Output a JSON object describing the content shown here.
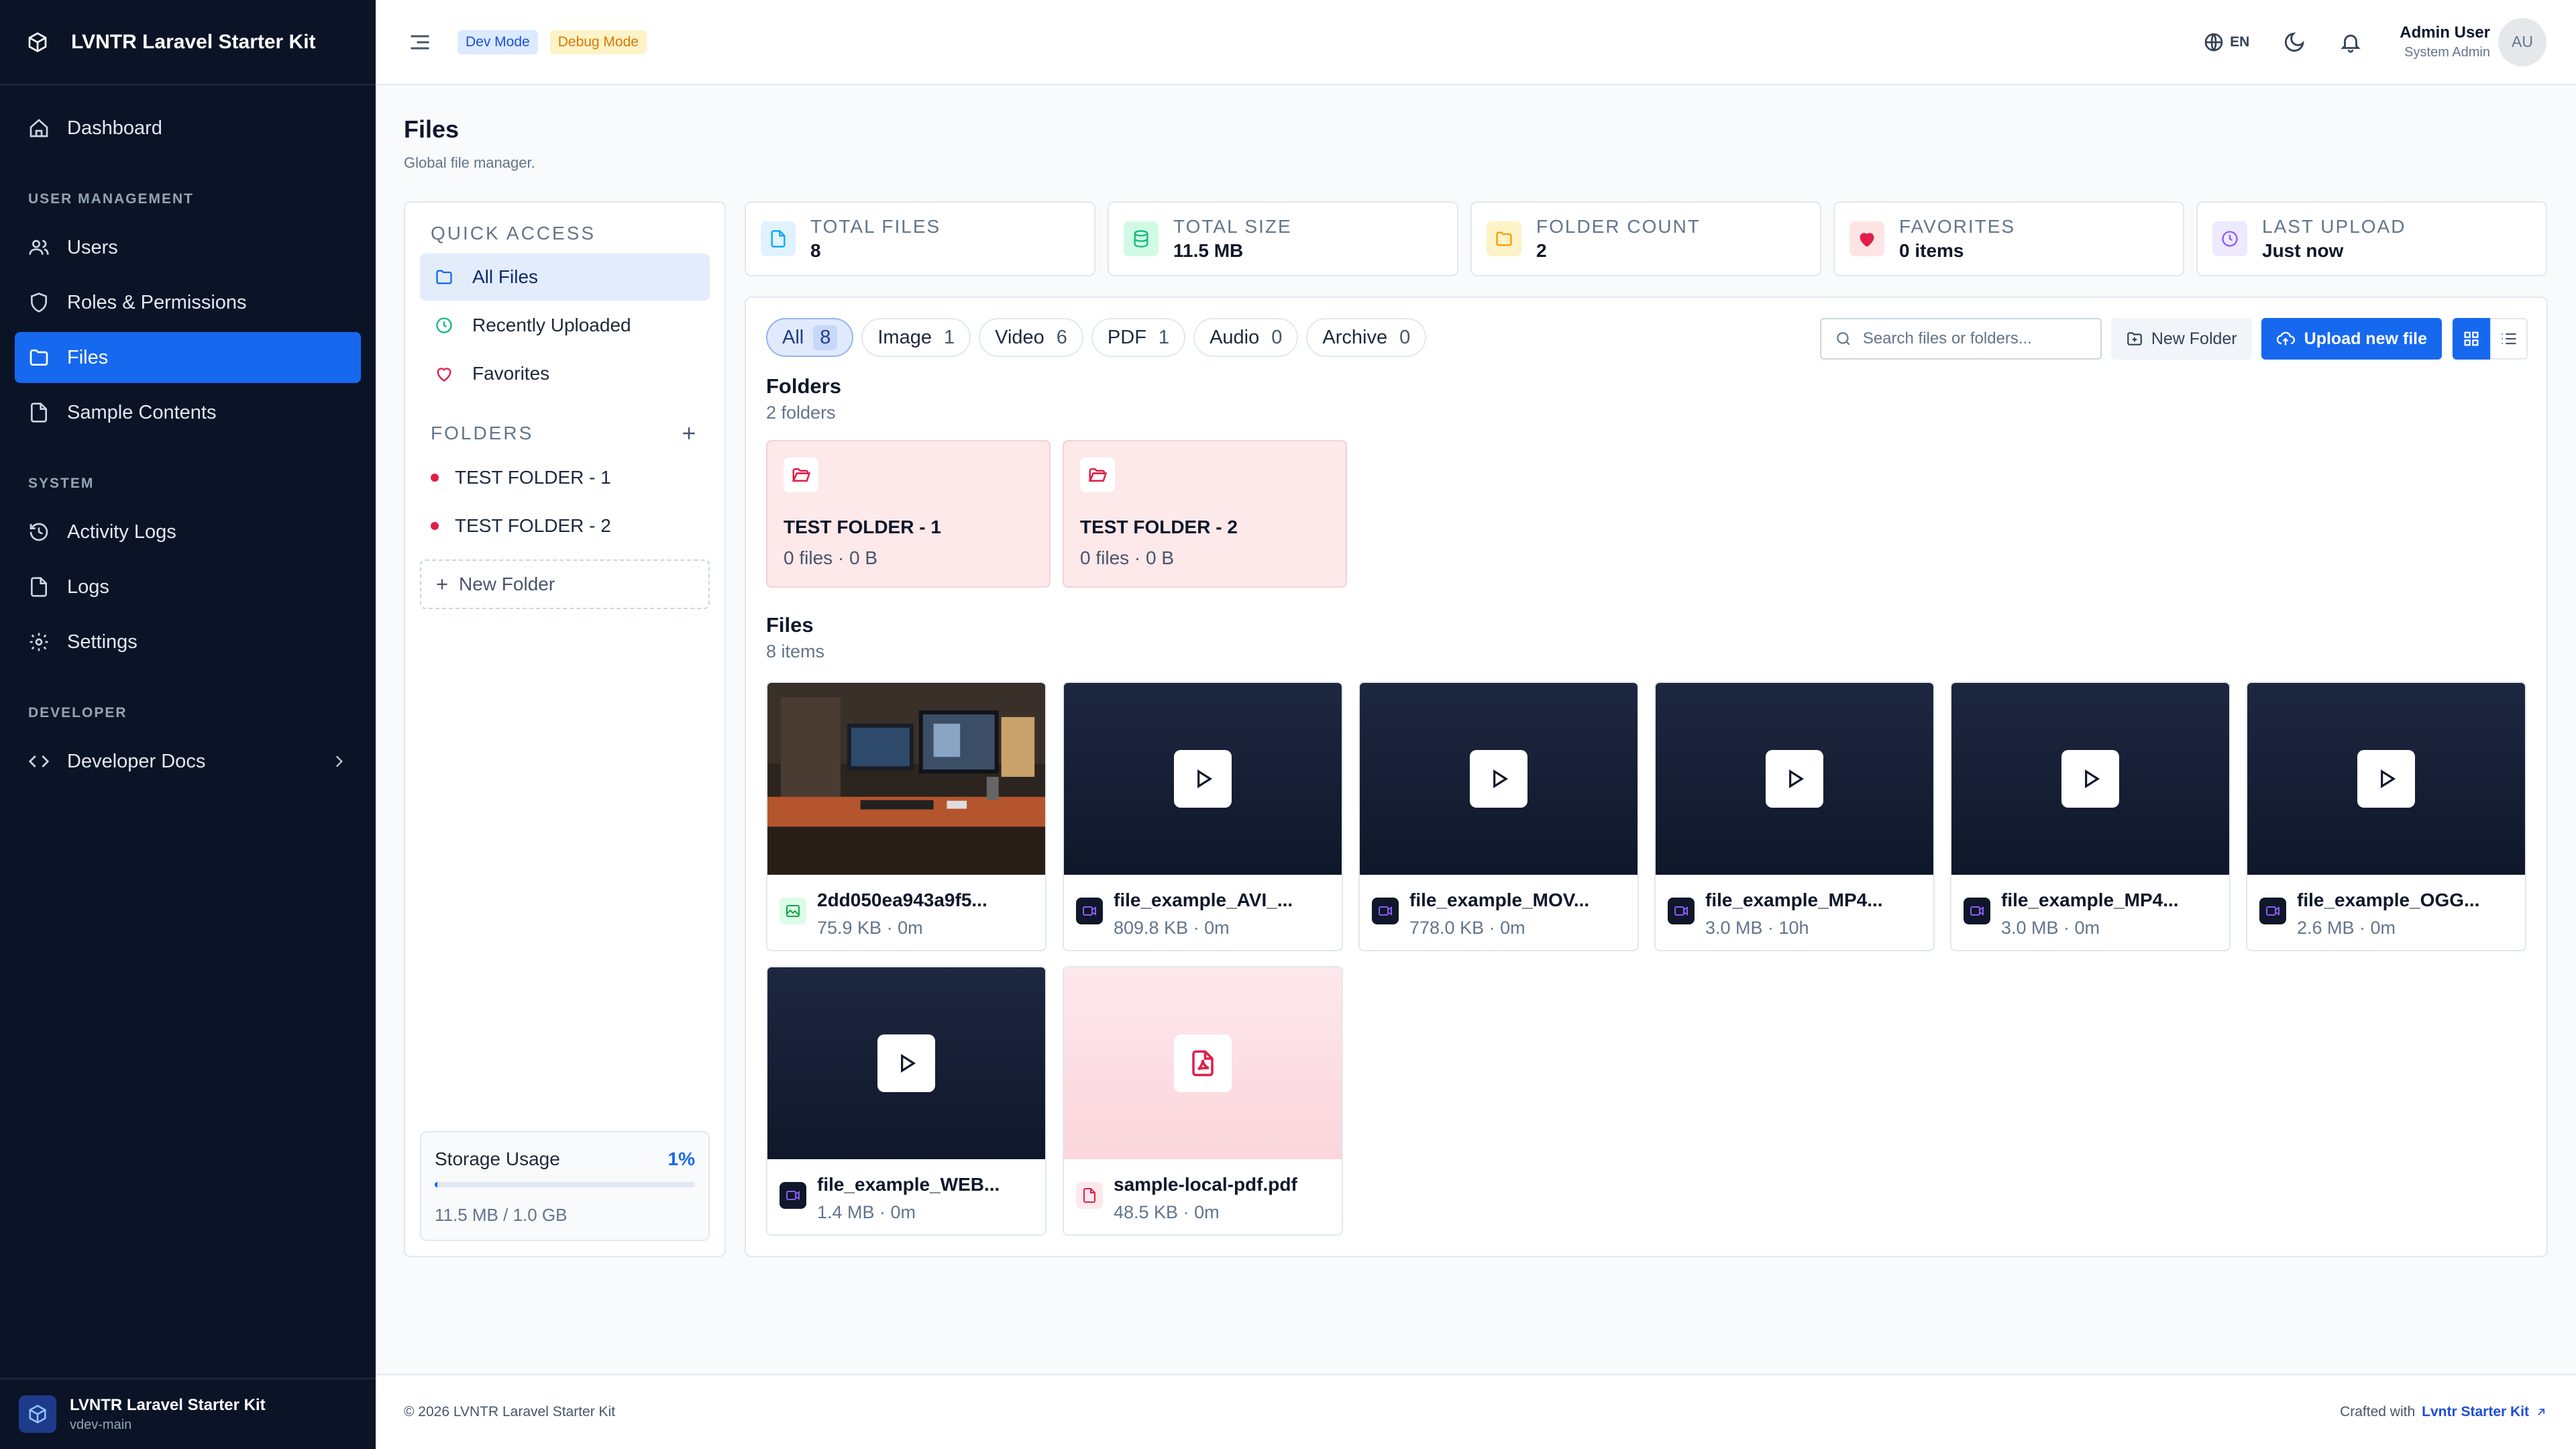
{
  "app": {
    "name": "LVNTR Laravel Starter Kit",
    "branch": "vdev-main"
  },
  "sidebar": {
    "dashboard": "Dashboard",
    "sections": {
      "user_management": "USER MANAGEMENT",
      "system": "SYSTEM",
      "developer": "DEVELOPER"
    },
    "items": {
      "users": "Users",
      "roles": "Roles & Permissions",
      "files": "Files",
      "sample_contents": "Sample Contents",
      "activity_logs": "Activity Logs",
      "logs": "Logs",
      "settings": "Settings",
      "developer_docs": "Developer Docs"
    },
    "active": "files"
  },
  "header": {
    "badges": {
      "dev": "Dev Mode",
      "debug": "Debug Mode"
    },
    "language": "EN",
    "user": {
      "name": "Admin User",
      "role": "System Admin",
      "initials": "AU"
    }
  },
  "page": {
    "title": "Files",
    "subtitle": "Global file manager."
  },
  "quick_access": {
    "heading": "QUICK ACCESS",
    "items": [
      "All Files",
      "Recently Uploaded",
      "Favorites"
    ],
    "active": "All Files"
  },
  "folders_panel": {
    "heading": "FOLDERS",
    "items": [
      "TEST FOLDER - 1",
      "TEST FOLDER - 2"
    ],
    "new_folder": "New Folder"
  },
  "storage": {
    "label": "Storage Usage",
    "percent_label": "1%",
    "used_fraction": 0.01,
    "size": "11.5 MB / 1.0 GB"
  },
  "stats": [
    {
      "label": "TOTAL FILES",
      "value": "8",
      "icon": "file-icon",
      "color": "#0ea5e9"
    },
    {
      "label": "TOTAL SIZE",
      "value": "11.5 MB",
      "icon": "database-icon",
      "color": "#10b981"
    },
    {
      "label": "FOLDER COUNT",
      "value": "2",
      "icon": "folder-icon",
      "color": "#f59e0b"
    },
    {
      "label": "FAVORITES",
      "value": "0 items",
      "icon": "heart-icon",
      "color": "#e11d48"
    },
    {
      "label": "LAST UPLOAD",
      "value": "Just now",
      "icon": "clock-icon",
      "color": "#8b5cf6"
    }
  ],
  "filters": [
    {
      "label": "All",
      "count": "8"
    },
    {
      "label": "Image",
      "count": "1"
    },
    {
      "label": "Video",
      "count": "6"
    },
    {
      "label": "PDF",
      "count": "1"
    },
    {
      "label": "Audio",
      "count": "0"
    },
    {
      "label": "Archive",
      "count": "0"
    }
  ],
  "toolbar": {
    "search_placeholder": "Search files or folders...",
    "new_folder": "New Folder",
    "upload": "Upload new file"
  },
  "folders": {
    "title": "Folders",
    "subtitle": "2 folders",
    "cards": [
      {
        "name": "TEST FOLDER - 1",
        "meta": "0 files · 0 B"
      },
      {
        "name": "TEST FOLDER - 2",
        "meta": "0 files · 0 B"
      }
    ]
  },
  "files": {
    "title": "Files",
    "subtitle": "8 items",
    "cards": [
      {
        "name": "2dd050ea943a9f5...",
        "meta": "75.9 KB · 0m",
        "kind": "image"
      },
      {
        "name": "file_example_AVI_...",
        "meta": "809.8 KB · 0m",
        "kind": "video"
      },
      {
        "name": "file_example_MOV...",
        "meta": "778.0 KB · 0m",
        "kind": "video"
      },
      {
        "name": "file_example_MP4...",
        "meta": "3.0 MB · 10h",
        "kind": "video"
      },
      {
        "name": "file_example_MP4...",
        "meta": "3.0 MB · 0m",
        "kind": "video"
      },
      {
        "name": "file_example_OGG...",
        "meta": "2.6 MB · 0m",
        "kind": "video"
      },
      {
        "name": "file_example_WEB...",
        "meta": "1.4 MB · 0m",
        "kind": "video"
      },
      {
        "name": "sample-local-pdf.pdf",
        "meta": "48.5 KB · 0m",
        "kind": "pdf"
      }
    ]
  },
  "footer": {
    "copyright": "© 2026 LVNTR Laravel Starter Kit",
    "crafted": "Crafted with",
    "link": "Lvntr Starter Kit"
  }
}
